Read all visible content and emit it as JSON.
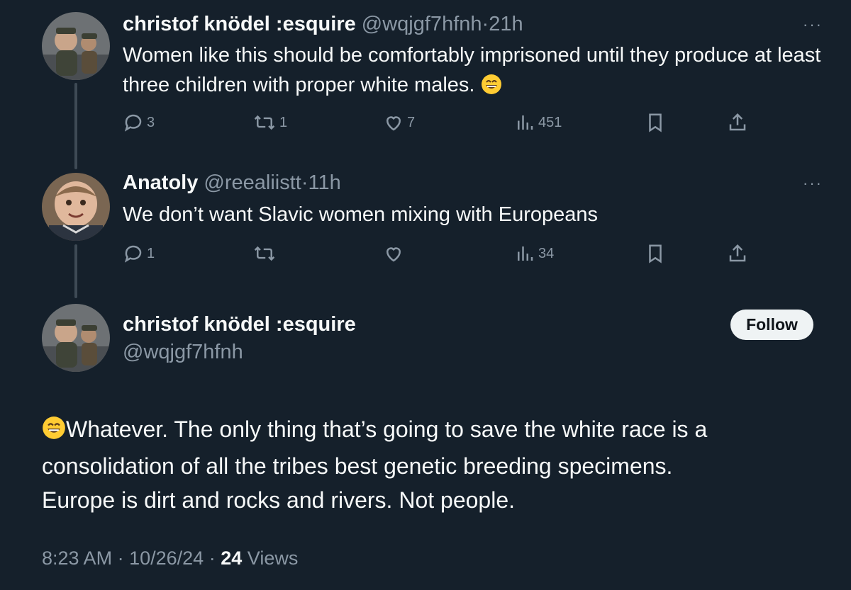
{
  "tweets": [
    {
      "author_name": "christof knödel :esquire",
      "handle": "@wqjgf7hfnh",
      "separator": "·",
      "time": "21h",
      "text": "Women like this should be comfortably imprisoned until they produce at least three children with proper white males.",
      "trailing_emoji": "grinning-face-smiling-eyes",
      "more_label": "···",
      "stats": {
        "replies": "3",
        "reposts": "1",
        "likes": "7",
        "views": "451"
      }
    },
    {
      "author_name": "Anatoly",
      "handle": "@reealiistt",
      "separator": "·",
      "time": "11h",
      "text": "We don’t want Slavic women mixing with Europeans",
      "more_label": "···",
      "stats": {
        "replies": "1",
        "reposts": "",
        "likes": "",
        "views": "34"
      }
    }
  ],
  "main_tweet": {
    "author_name": "christof knödel :esquire",
    "handle": "@wqjgf7hfnh",
    "follow_label": "Follow",
    "leading_emoji": "grinning-face-smiling-eyes",
    "text_line1": "Whatever. The only thing that’s going to save the white race is a",
    "text_line2": "consolidation of all the tribes best genetic breeding specimens.",
    "text_line3": "Europe is dirt and rocks and rivers. Not people.",
    "time": "8:23 AM",
    "date": "10/26/24",
    "separator": "·",
    "views_count": "24",
    "views_label": "Views"
  },
  "colors": {
    "background": "#15202b",
    "text": "#f7f9f9",
    "muted": "#8b98a5",
    "thread_line": "#3e4a55",
    "follow_bg": "#eff3f4"
  }
}
